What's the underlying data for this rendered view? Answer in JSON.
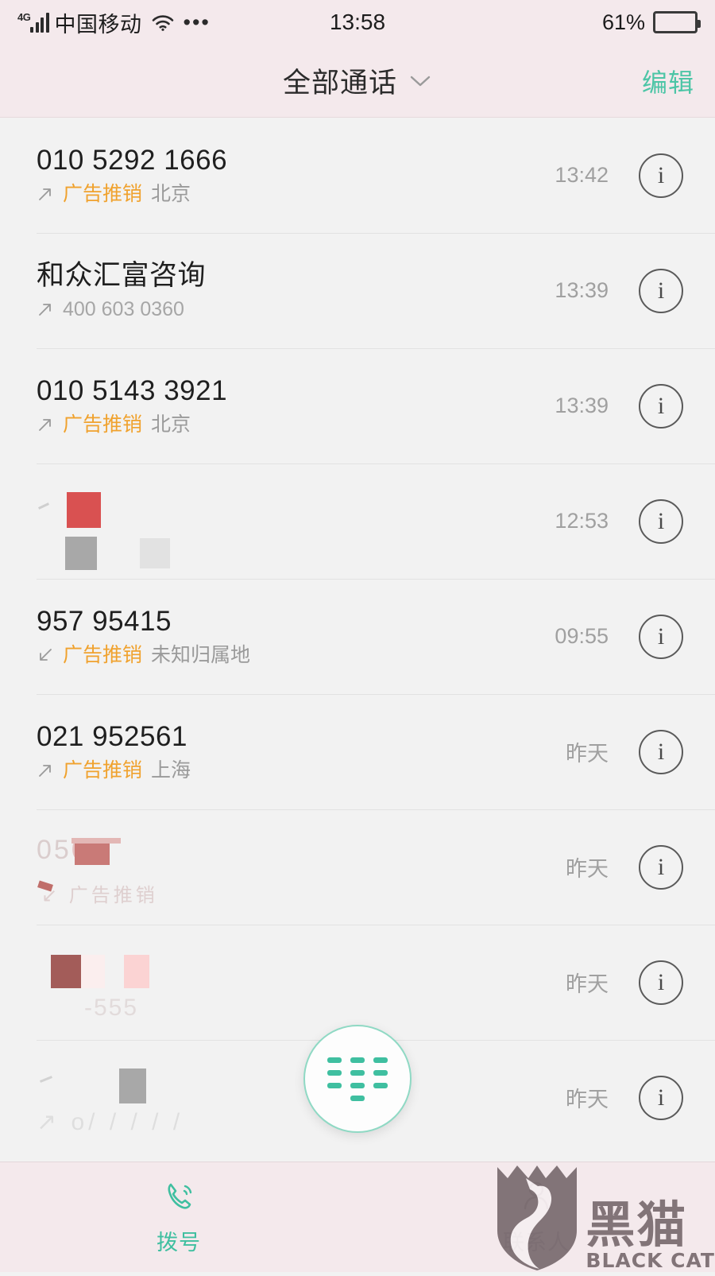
{
  "colors": {
    "header_bg": "#f4e9ec",
    "list_bg": "#f2f2f2",
    "accent_teal": "#3fbfa0",
    "tag_orange": "#f0a22e",
    "time_gray": "#a0a0a0",
    "watermark": "#7c6e72"
  },
  "status_bar": {
    "network_type": "4G",
    "carrier": "中国移动",
    "more_dots": "•••",
    "time": "13:58",
    "battery_percent": "61%",
    "battery_level": 61,
    "icons": [
      "signal-bars-icon",
      "wifi-icon",
      "more-dots-icon",
      "battery-icon"
    ]
  },
  "header": {
    "title": "全部通话",
    "dropdown_icon": "chevron-down-icon",
    "edit_label": "编辑"
  },
  "call_log": {
    "rows": [
      {
        "title": "010 5292 1666",
        "direction": "outgoing",
        "direction_icon": "arrow-outgoing-icon",
        "tag": "广告推销",
        "location": "北京",
        "time": "13:42",
        "info_icon": "info-icon",
        "redacted": false
      },
      {
        "title": "和众汇富咨询",
        "direction": "outgoing",
        "direction_icon": "arrow-outgoing-icon",
        "tag": "",
        "location": "",
        "number": "400 603 0360",
        "time": "13:39",
        "info_icon": "info-icon",
        "redacted": false
      },
      {
        "title": "010 5143 3921",
        "direction": "outgoing",
        "direction_icon": "arrow-outgoing-icon",
        "tag": "广告推销",
        "location": "北京",
        "time": "13:39",
        "info_icon": "info-icon",
        "redacted": false
      },
      {
        "title": "",
        "direction": "outgoing",
        "direction_icon": "arrow-outgoing-icon",
        "tag": "",
        "location": "",
        "time": "12:53",
        "info_icon": "info-icon",
        "redacted": true,
        "redaction_style": "red-gray-blocks"
      },
      {
        "title": "957 95415",
        "direction": "incoming",
        "direction_icon": "arrow-incoming-icon",
        "tag": "广告推销",
        "location": "未知归属地",
        "time": "09:55",
        "info_icon": "info-icon",
        "redacted": false
      },
      {
        "title": "021 952561",
        "direction": "outgoing",
        "direction_icon": "arrow-outgoing-icon",
        "tag": "广告推销",
        "location": "上海",
        "time": "昨天",
        "info_icon": "info-icon",
        "redacted": false
      },
      {
        "title": "",
        "direction": "incoming",
        "direction_icon": "arrow-incoming-icon",
        "tag": "",
        "location": "",
        "time": "昨天",
        "info_icon": "info-icon",
        "redacted": true,
        "redaction_style": "pink-smear"
      },
      {
        "title": "",
        "direction": "",
        "direction_icon": "",
        "tag": "",
        "location": "",
        "time": "昨天",
        "info_icon": "info-icon",
        "redacted": true,
        "redaction_style": "pink-blocks"
      },
      {
        "title": "",
        "direction": "",
        "direction_icon": "",
        "tag": "",
        "location": "",
        "time": "昨天",
        "info_icon": "info-icon",
        "redacted": true,
        "redaction_style": "gray-block"
      }
    ]
  },
  "fab": {
    "icon": "dialpad-icon",
    "label": ""
  },
  "tabbar": {
    "tabs": [
      {
        "label": "拨号",
        "icon": "phone-icon",
        "active": true
      },
      {
        "label": "联系人",
        "icon": "person-icon",
        "active": false
      }
    ]
  },
  "watermark": {
    "cn": "黑猫",
    "en": "BLACK CAT",
    "icon": "black-cat-shield-icon"
  }
}
